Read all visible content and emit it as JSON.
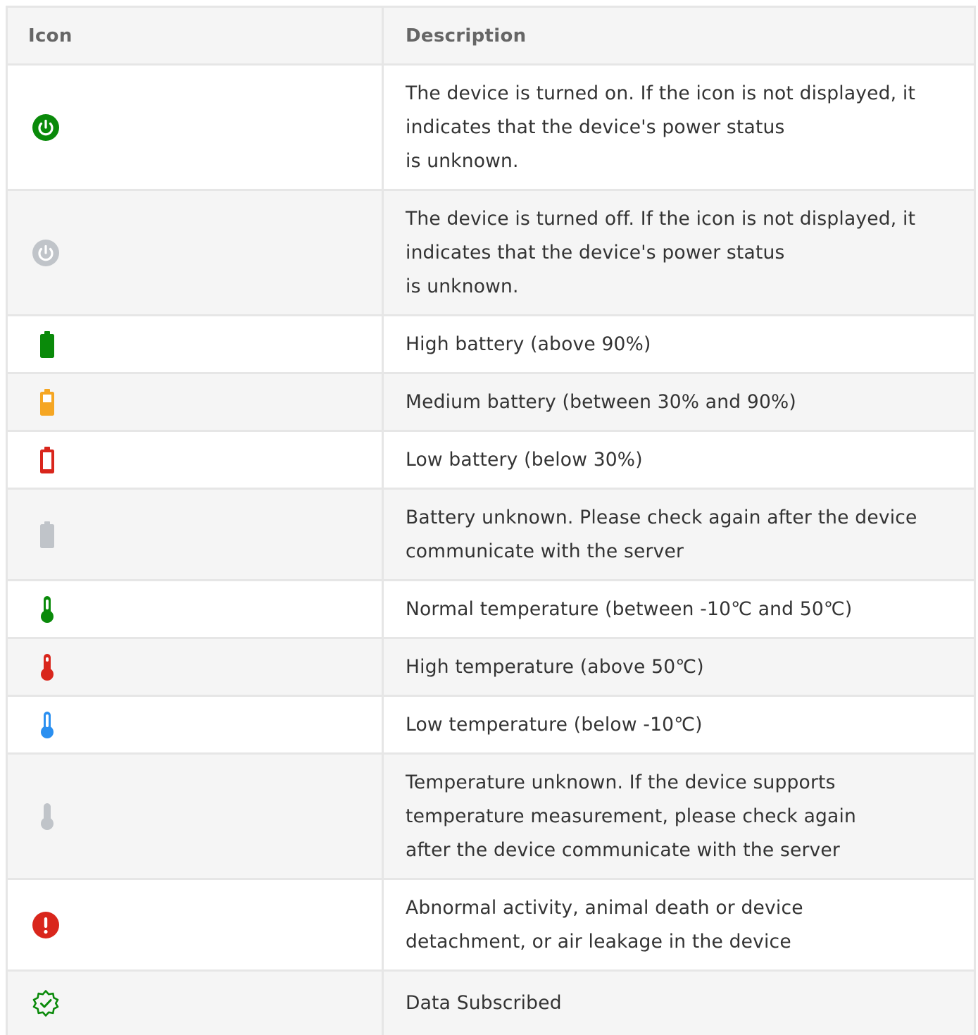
{
  "table": {
    "headers": {
      "icon": "Icon",
      "description": "Description"
    },
    "rows": [
      {
        "icon": "power-on-icon",
        "color": "#0a8a0a",
        "text": "The device is turned on. If the icon is not displayed, it\nindicates that the device's power status\nis unknown."
      },
      {
        "icon": "power-off-icon",
        "color": "#c0c4c9",
        "text": "The device is turned off. If the icon is not displayed, it\nindicates that the device's power status\nis unknown."
      },
      {
        "icon": "battery-high-icon",
        "color": "#0a8a0a",
        "text": "High battery (above 90%)"
      },
      {
        "icon": "battery-medium-icon",
        "color": "#f5a623",
        "text": "Medium battery (between 30% and 90%)"
      },
      {
        "icon": "battery-low-icon",
        "color": "#d9261c",
        "text": "Low battery (below 30%)"
      },
      {
        "icon": "battery-unknown-icon",
        "color": "#c0c4c9",
        "text": "Battery unknown. Please check again after the device\ncommunicate with the server"
      },
      {
        "icon": "thermometer-normal-icon",
        "color": "#0a8a0a",
        "text": "Normal temperature (between -10℃ and 50℃)"
      },
      {
        "icon": "thermometer-high-icon",
        "color": "#d9261c",
        "text": "High temperature (above 50℃)"
      },
      {
        "icon": "thermometer-low-icon",
        "color": "#2a8ff0",
        "text": "Low temperature (below -10℃)"
      },
      {
        "icon": "thermometer-unknown-icon",
        "color": "#c0c4c9",
        "text": "Temperature unknown. If the device supports\ntemperature measurement, please check again\nafter the device communicate with the server"
      },
      {
        "icon": "alert-icon",
        "color": "#d9261c",
        "text": "Abnormal activity, animal death or device\ndetachment, or air leakage in the device"
      },
      {
        "icon": "data-subscribed-icon",
        "color": "#0a8a0a",
        "text": "Data Subscribed"
      }
    ]
  }
}
